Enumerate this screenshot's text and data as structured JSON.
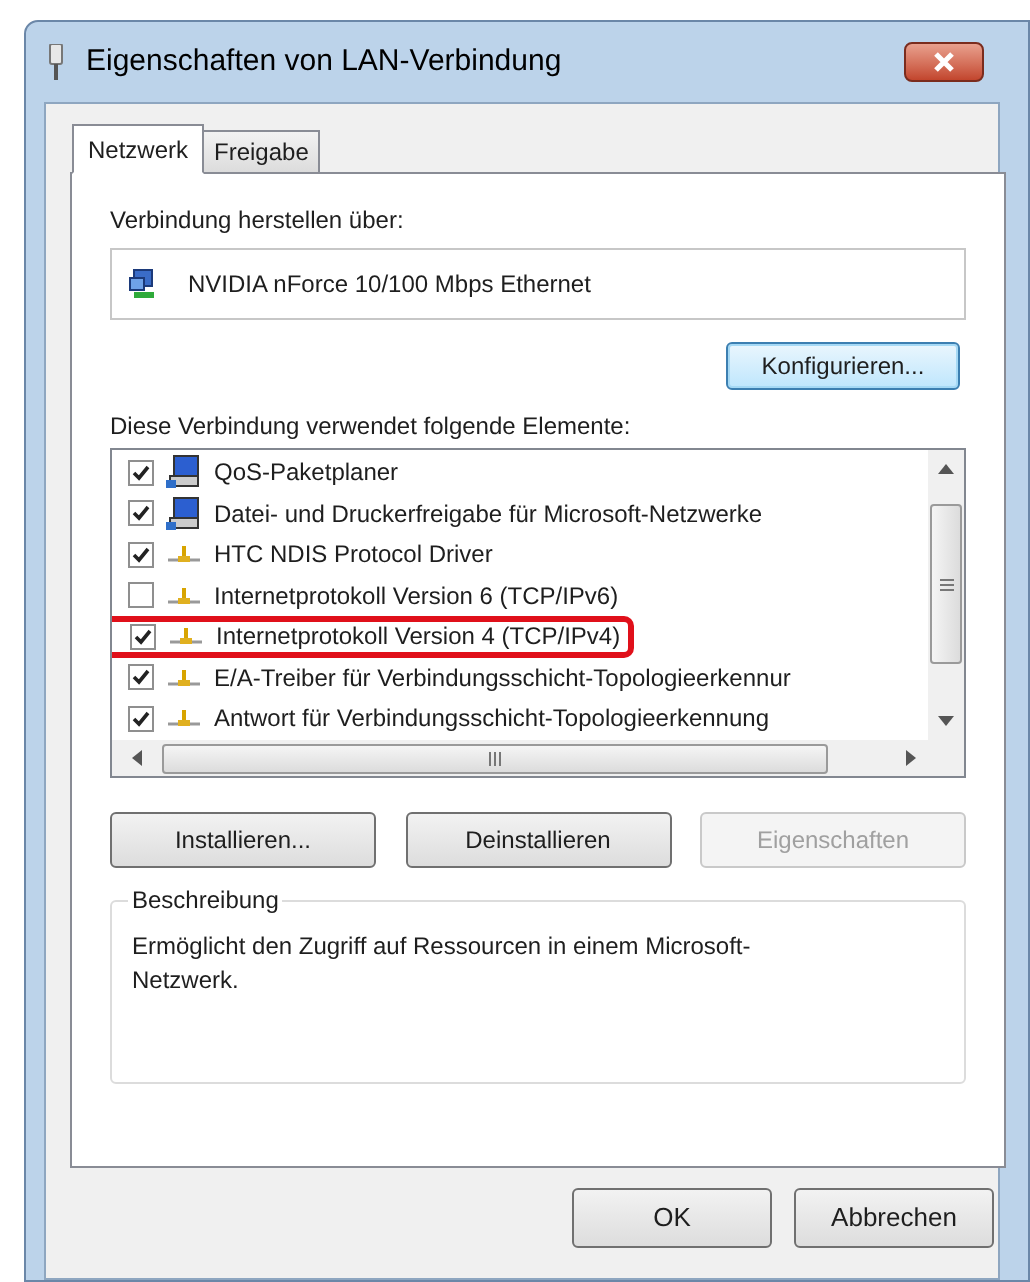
{
  "window": {
    "title": "Eigenschaften von LAN-Verbindung"
  },
  "tabs": [
    {
      "label": "Netzwerk",
      "selected": true
    },
    {
      "label": "Freigabe",
      "selected": false
    }
  ],
  "connect_label": "Verbindung herstellen über:",
  "adapter": "NVIDIA nForce 10/100 Mbps Ethernet",
  "configure_button": "Konfigurieren...",
  "elements_label": "Diese Verbindung verwendet folgende Elemente:",
  "elements": [
    {
      "kind": "service",
      "label": "QoS-Paketplaner",
      "checked": true,
      "highlighted": false
    },
    {
      "kind": "service",
      "label": "Datei- und Druckerfreigabe für Microsoft-Netzwerke",
      "checked": true,
      "highlighted": false
    },
    {
      "kind": "protocol",
      "label": "HTC NDIS Protocol Driver",
      "checked": true,
      "highlighted": false
    },
    {
      "kind": "protocol",
      "label": "Internetprotokoll Version 6 (TCP/IPv6)",
      "checked": false,
      "highlighted": false
    },
    {
      "kind": "protocol",
      "label": "Internetprotokoll Version 4 (TCP/IPv4)",
      "checked": true,
      "highlighted": true
    },
    {
      "kind": "protocol",
      "label": "E/A-Treiber für Verbindungsschicht-Topologieerkennur",
      "checked": true,
      "highlighted": false
    },
    {
      "kind": "protocol",
      "label": "Antwort für Verbindungsschicht-Topologieerkennung",
      "checked": true,
      "highlighted": false
    }
  ],
  "action_buttons": [
    {
      "label": "Installieren...",
      "disabled": false
    },
    {
      "label": "Deinstallieren",
      "disabled": false
    },
    {
      "label": "Eigenschaften",
      "disabled": true
    }
  ],
  "description": {
    "title": "Beschreibung",
    "text": "Ermöglicht den Zugriff auf Ressourcen in einem Microsoft-Netzwerk."
  },
  "dialog_buttons": [
    {
      "label": "OK"
    },
    {
      "label": "Abbrechen"
    }
  ]
}
